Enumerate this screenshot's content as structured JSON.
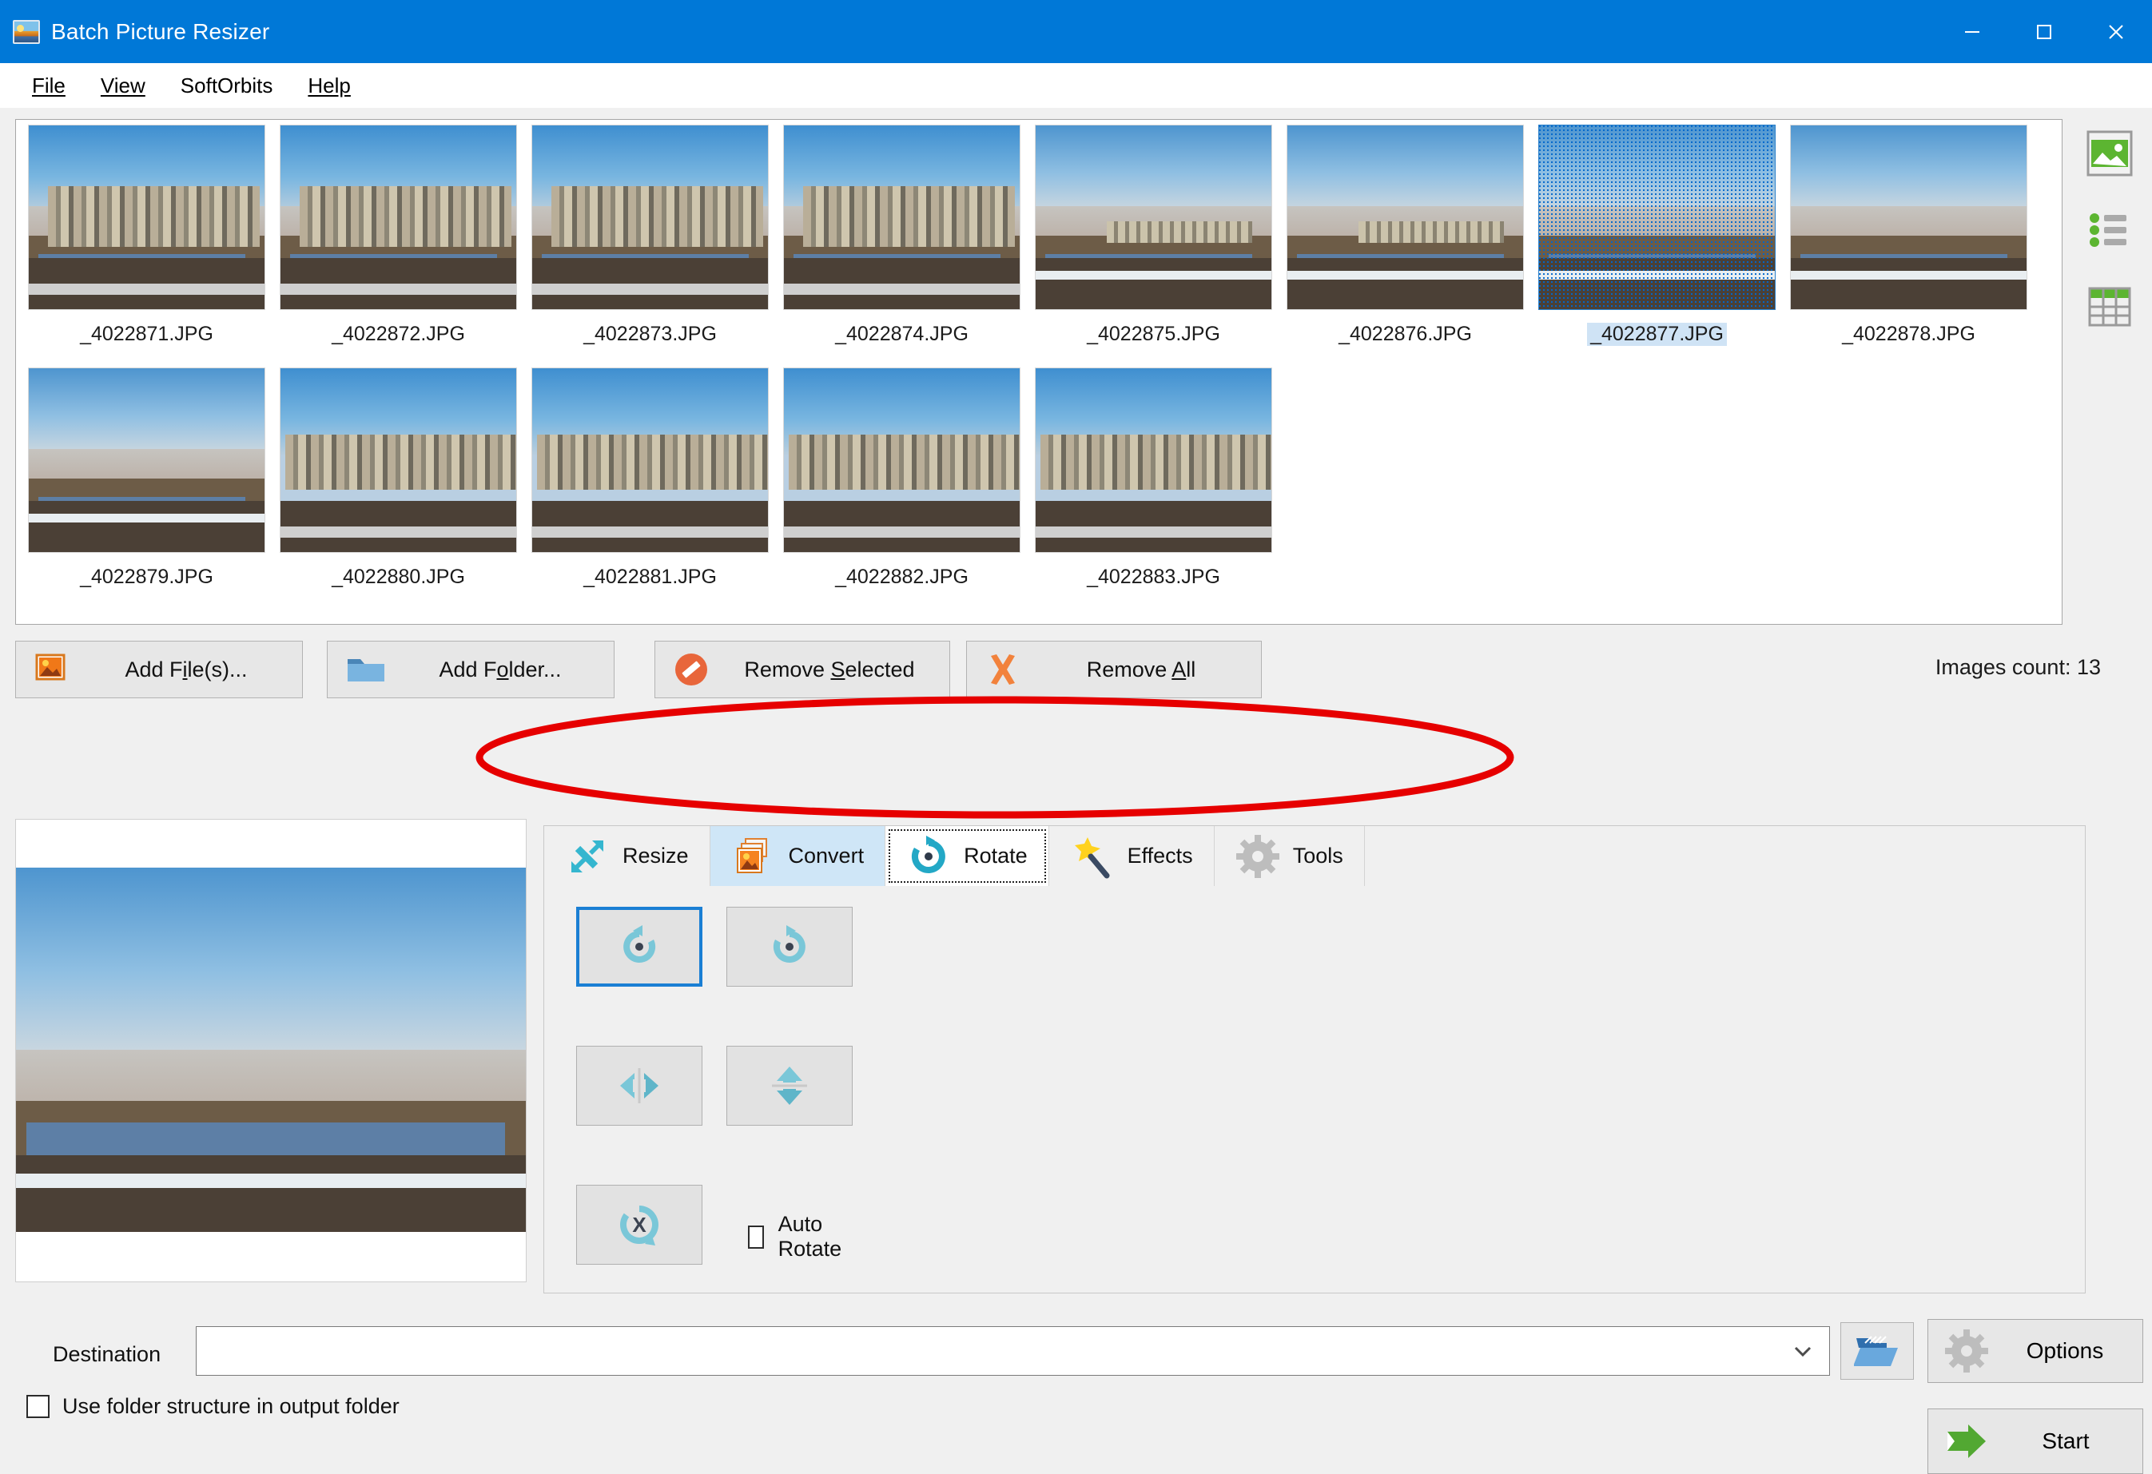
{
  "window": {
    "title": "Batch Picture Resizer",
    "app_icon": "picture-app-icon",
    "minimize": "–",
    "maximize": "□",
    "close": "✕",
    "titlebar_color": "#0078d7"
  },
  "menu": {
    "items": [
      {
        "label": "File",
        "accel": "F"
      },
      {
        "label": "View",
        "accel": "V"
      },
      {
        "label": "SoftOrbits",
        "accel": ""
      },
      {
        "label": "Help",
        "accel": "H"
      }
    ]
  },
  "thumbnails": {
    "selected_index": 6,
    "row1": [
      {
        "name": "_4022871.JPG",
        "scene": "city"
      },
      {
        "name": "_4022872.JPG",
        "scene": "city"
      },
      {
        "name": "_4022873.JPG",
        "scene": "city"
      },
      {
        "name": "_4022874.JPG",
        "scene": "city"
      },
      {
        "name": "_4022875.JPG",
        "scene": "shore"
      },
      {
        "name": "_4022876.JPG",
        "scene": "shore"
      },
      {
        "name": "_4022877.JPG",
        "scene": "shore"
      },
      {
        "name": "_4022878.JPG",
        "scene": "shore"
      }
    ],
    "row2": [
      {
        "name": "_4022879.JPG",
        "scene": "shore"
      },
      {
        "name": "_4022880.JPG",
        "scene": "city"
      },
      {
        "name": "_4022881.JPG",
        "scene": "city"
      },
      {
        "name": "_4022882.JPG",
        "scene": "city"
      },
      {
        "name": "_4022883.JPG",
        "scene": "city"
      }
    ]
  },
  "view_modes": [
    {
      "name": "thumbnail-view",
      "icon": "image-icon"
    },
    {
      "name": "list-view",
      "icon": "list-icon"
    },
    {
      "name": "table-view",
      "icon": "grid-icon"
    }
  ],
  "toolbar": {
    "add_files": "Add File(s)...",
    "add_files_accel": "i",
    "add_folder": "Add Folder...",
    "add_folder_accel": "o",
    "remove_selected": "Remove Selected",
    "remove_selected_accel": "S",
    "remove_all": "Remove All",
    "remove_all_accel": "A",
    "images_count": "Images count: 13"
  },
  "tabs": {
    "active": "Rotate",
    "items": [
      {
        "label": "Resize",
        "icon": "resize-arrow-icon",
        "state": "normal"
      },
      {
        "label": "Convert",
        "icon": "convert-image-icon",
        "state": "hover"
      },
      {
        "label": "Rotate",
        "icon": "rotate-icon",
        "state": "active"
      },
      {
        "label": "Effects",
        "icon": "magic-wand-icon",
        "state": "normal"
      },
      {
        "label": "Tools",
        "icon": "gear-icon",
        "state": "normal"
      }
    ]
  },
  "rotate_panel": {
    "buttons": [
      {
        "name": "rotate-left-button",
        "icon": "rotate-ccw-icon",
        "selected": true
      },
      {
        "name": "rotate-right-button",
        "icon": "rotate-cw-icon",
        "selected": false
      },
      {
        "name": "flip-horizontal-button",
        "icon": "flip-h-icon",
        "selected": false
      },
      {
        "name": "flip-vertical-button",
        "icon": "flip-v-icon",
        "selected": false
      },
      {
        "name": "reset-rotation-button",
        "icon": "rotate-x-icon",
        "selected": false
      }
    ],
    "auto_rotate_label": "Auto Rotate",
    "auto_rotate_checked": false
  },
  "bottom": {
    "destination_label": "Destination",
    "destination_value": "",
    "destination_placeholder": "",
    "use_folder_structure_label": "Use folder structure in output folder",
    "use_folder_structure_checked": false,
    "browse_icon": "open-folder-icon",
    "options_label": "Options",
    "options_icon": "gear-icon",
    "start_label": "Start",
    "start_icon": "green-arrow-icon"
  },
  "annotation": {
    "shape": "ellipse",
    "color": "#e60000",
    "stroke_width": 9,
    "target": "tab-strip"
  }
}
